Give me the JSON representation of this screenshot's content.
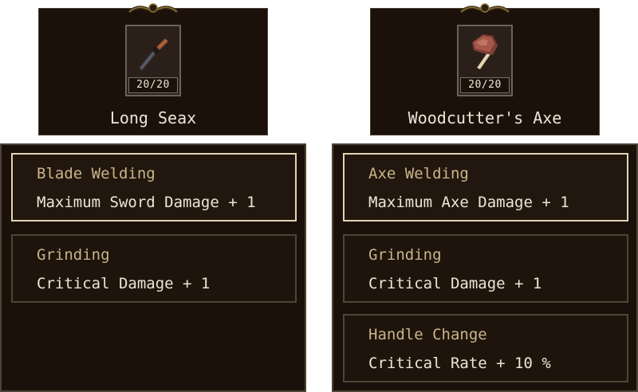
{
  "items": [
    {
      "name": "Long Seax",
      "icon": "seax-blade-icon",
      "durability": "20/20",
      "modifications": [
        {
          "title": "Blade Welding",
          "effect": "Maximum Sword Damage + 1",
          "selected": true
        },
        {
          "title": "Grinding",
          "effect": "Critical Damage + 1",
          "selected": false
        }
      ]
    },
    {
      "name": "Woodcutter's Axe",
      "icon": "axe-icon",
      "durability": "20/20",
      "modifications": [
        {
          "title": "Axe Welding",
          "effect": "Maximum Axe Damage + 1",
          "selected": true
        },
        {
          "title": "Grinding",
          "effect": "Critical Damage + 1",
          "selected": false
        },
        {
          "title": "Handle Change",
          "effect": "Critical Rate + 10 %",
          "selected": false
        }
      ]
    }
  ],
  "colors": {
    "panel_bg": "#1b110a",
    "panel_border": "#4d4436",
    "selected_border": "#e0d5b4",
    "title_text": "#c9b489",
    "effect_text": "#ece6d6"
  }
}
